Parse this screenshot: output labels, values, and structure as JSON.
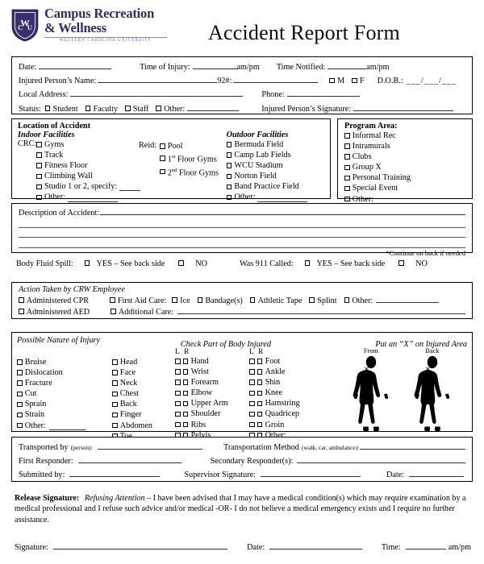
{
  "header": {
    "logo": {
      "shield_text": "WCU",
      "line1": "Campus Recreation",
      "line2": "& Wellness",
      "subtitle": "WESTERN CAROLINA UNIVERSITY",
      "color": "#332A6B"
    },
    "title": "Accident Report Form"
  },
  "section_info": {
    "date_label": "Date:",
    "time_injury_label": "Time of Injury:",
    "ampm1": "am/pm",
    "time_notified_label": "Time Notified:",
    "ampm2": "am/pm",
    "name_label": "Injured Person’s Name:",
    "id_label": "92#:",
    "m_label": "M",
    "f_label": "F",
    "dob_label": "D.O.B.:",
    "dob_slashes": "___/___/___",
    "address_label": "Local Address:",
    "phone_label": "Phone:",
    "status_label": "Status:",
    "status_options": [
      "Student",
      "Faculty",
      "Staff"
    ],
    "status_other": "Other:",
    "signature_label": "Injured Person’s Signature:"
  },
  "location": {
    "heading": "Location of Accident",
    "indoor_heading": "Indoor Facilities",
    "outdoor_heading": "Outdoor Facilities",
    "crc_label": "CRC:",
    "crc_items": [
      "Gyms",
      "Track",
      "Fitness Floor",
      "Climbing Wall"
    ],
    "crc_studio": "Studio 1 or 2, specify:",
    "crc_other": "Other:",
    "reid_label": "Reid:",
    "reid_items": [
      "Pool",
      "1st Floor Gyms",
      "2nd Floor Gyms"
    ],
    "reid_items_sup": [
      {
        "text": "Pool",
        "pre": "",
        "sup": ""
      },
      {
        "pre": "1",
        "sup": "st",
        "text": " Floor Gyms"
      },
      {
        "pre": "2",
        "sup": "nd",
        "text": " Floor Gyms"
      }
    ],
    "outdoor_items": [
      "Bermuda Field",
      "Camp Lab Fields",
      "WCU Stadium",
      "Norton Field",
      "Band Practice Field"
    ],
    "outdoor_other": "Other:"
  },
  "program_area": {
    "heading": "Program Area:",
    "items": [
      "Informal Rec",
      "Intramurals",
      "Clubs",
      "Group X",
      "Personal Training",
      "Special Event"
    ],
    "other": "Other:"
  },
  "description": {
    "label": "Description of Accident:",
    "note": "*Continue on back if needed"
  },
  "fluid_row": {
    "spill_label": "Body Fluid Spill:",
    "yes_label": "YES – See back side",
    "no_label": "NO",
    "call_label": "Was 911 Called:",
    "yes_label2": "YES – See back side",
    "no_label2": "NO"
  },
  "action_taken": {
    "heading": "Action Taken by CRW Employee",
    "cpr": "Administered CPR",
    "aed": "Administered AED",
    "first_aid": "First Aid Care:",
    "first_aid_items": [
      "Ice",
      "Bandage(s)",
      "Athletic Tape",
      "Splint"
    ],
    "first_aid_other": "Other:",
    "additional": "Additional Care:"
  },
  "injury": {
    "nature_heading": "Possible Nature of Injury",
    "part_heading": "Check Part of Body Injured",
    "xmark_heading": "Put an “X” on Injured Area",
    "nature_items": [
      "Bruise",
      "Dislocation",
      "Fracture",
      "Cut",
      "Sprain",
      "Strain"
    ],
    "nature_other": "Other:",
    "center_items": [
      "Head",
      "Face",
      "Neck",
      "Chest",
      "Back",
      "Finger",
      "Abdomen",
      "Toe"
    ],
    "lr_l": "L",
    "lr_r": "R",
    "lr_col1": [
      "Hand",
      "Wrist",
      "Forearm",
      "Elbow",
      "Upper Arm",
      "Shoulder",
      "Ribs",
      "Pelvis"
    ],
    "lr_col2": [
      "Foot",
      "Ankle",
      "Shin",
      "Knee",
      "Hamstring",
      "Quadricep",
      "Groin"
    ],
    "lr_col2_other": "Other:",
    "front_caption": "Front",
    "back_caption": "Back"
  },
  "transport": {
    "transported_by": "Transported by",
    "transported_by_note": "(person):",
    "method": "Transportation Method",
    "method_note": "(walk, car, ambulance):",
    "first_responder": "First Responder:",
    "secondary_responder": "Secondary Responder(s):",
    "submitted_by": "Submitted by:",
    "supervisor_signature": "Supervisor Signature:",
    "date": "Date:"
  },
  "release": {
    "heading": "Release Signature",
    "colon": ":",
    "italic_part": "Refusing Attention",
    "body": " – I have been advised that I may have a medical condition(s) which may require examination by a medical professional and I refuse such advice and/or medical -OR- I do not believe a medical emergency exists and I require no further assistance.",
    "signature_label": "Signature:",
    "date_label": "Date:",
    "time_label": "Time:",
    "ampm": "am/pm"
  }
}
